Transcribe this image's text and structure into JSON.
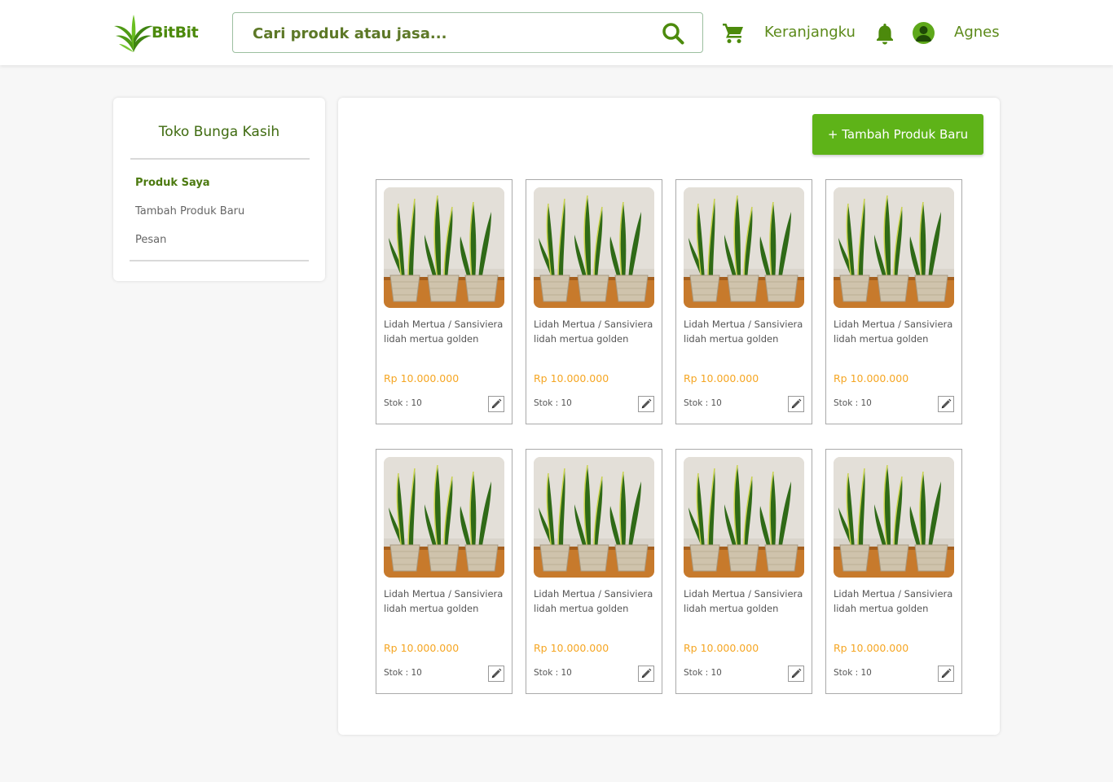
{
  "header": {
    "brand": "BitBit",
    "search_placeholder": "Cari produk atau jasa...",
    "cart_label": "Keranjangku",
    "user_name": "Agnes"
  },
  "sidebar": {
    "shop_name": "Toko Bunga Kasih",
    "items": [
      {
        "label": "Produk Saya",
        "active": true
      },
      {
        "label": "Tambah Produk Baru",
        "active": false
      },
      {
        "label": "Pesan",
        "active": false
      }
    ]
  },
  "main": {
    "add_button_label": "+ Tambah Produk Baru",
    "products": [
      {
        "name": "Lidah Mertua / Sansiviera lidah mertua golden",
        "price": "Rp 10.000.000",
        "stock": "Stok : 10"
      },
      {
        "name": "Lidah Mertua / Sansiviera lidah mertua golden",
        "price": "Rp 10.000.000",
        "stock": "Stok : 10"
      },
      {
        "name": "Lidah Mertua / Sansiviera lidah mertua golden",
        "price": "Rp 10.000.000",
        "stock": "Stok : 10"
      },
      {
        "name": "Lidah Mertua / Sansiviera lidah mertua golden",
        "price": "Rp 10.000.000",
        "stock": "Stok : 10"
      },
      {
        "name": "Lidah Mertua / Sansiviera lidah mertua golden",
        "price": "Rp 10.000.000",
        "stock": "Stok : 10"
      },
      {
        "name": "Lidah Mertua / Sansiviera lidah mertua golden",
        "price": "Rp 10.000.000",
        "stock": "Stok : 10"
      },
      {
        "name": "Lidah Mertua / Sansiviera lidah mertua golden",
        "price": "Rp 10.000.000",
        "stock": "Stok : 10"
      },
      {
        "name": "Lidah Mertua / Sansiviera lidah mertua golden",
        "price": "Rp 10.000.000",
        "stock": "Stok : 10"
      }
    ]
  },
  "colors": {
    "brand_green": "#5eb318",
    "text_green": "#4c7a10",
    "price_orange": "#f5a623"
  }
}
